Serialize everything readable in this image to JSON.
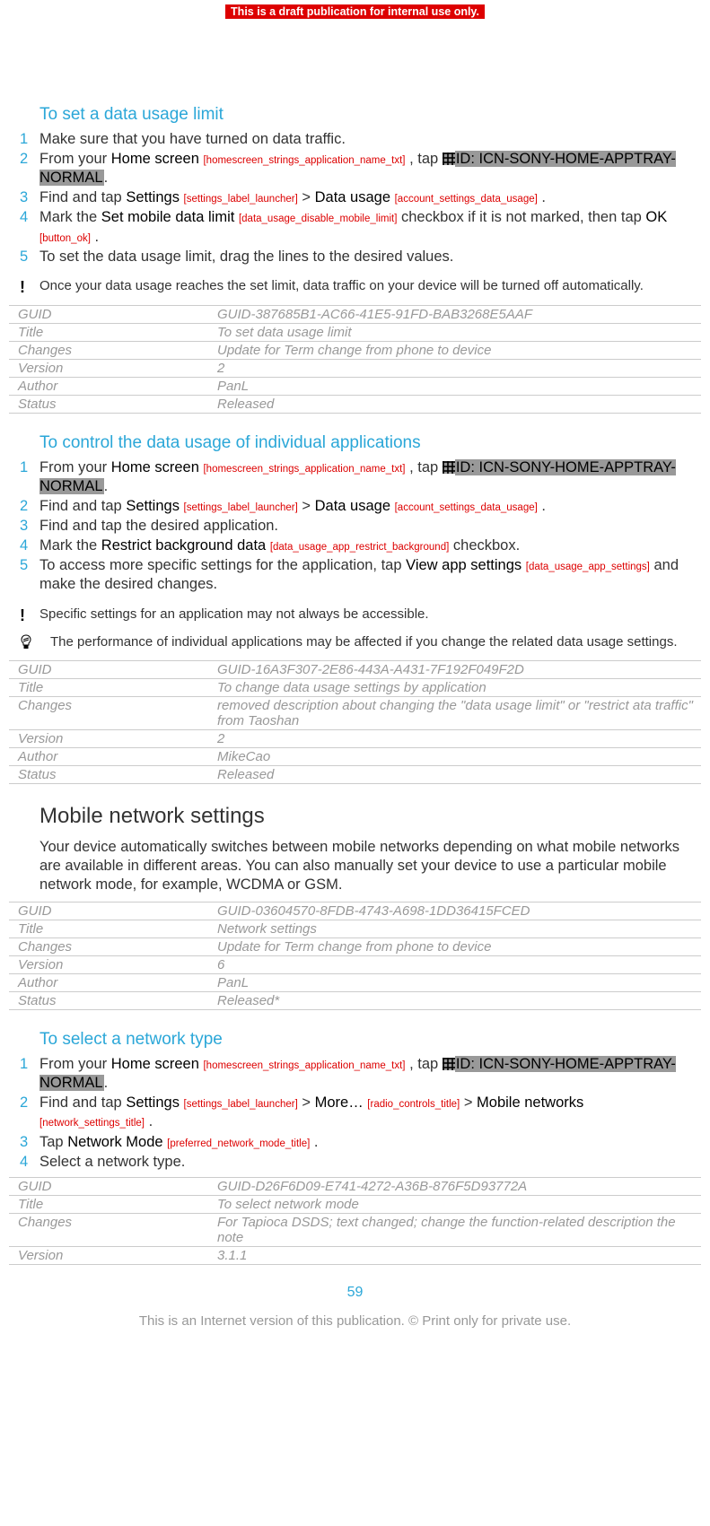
{
  "banner": "This is a draft publication for internal use only.",
  "sec1": {
    "title": "To set a data usage limit",
    "steps": [
      {
        "n": "1",
        "parts": [
          "Make sure that you have turned on data traffic."
        ]
      },
      {
        "n": "2",
        "parts": [
          "From your ",
          "Home screen",
          " [homescreen_strings_application_name_txt] ",
          ", tap ",
          "ID: ICN-SONY-HOME-APPTRAY-NORMAL",
          "."
        ]
      },
      {
        "n": "3",
        "parts": [
          "Find and tap ",
          "Settings",
          " [settings_label_launcher] ",
          " > ",
          "Data usage",
          " [account_settings_data_usage] ",
          "."
        ]
      },
      {
        "n": "4",
        "parts": [
          "Mark the ",
          "Set mobile data limit",
          " [data_usage_disable_mobile_limit] ",
          " checkbox if it is not marked, then tap ",
          "OK",
          " [button_ok] ",
          "."
        ]
      },
      {
        "n": "5",
        "parts": [
          "To set the data usage limit, drag the lines to the desired values."
        ]
      }
    ],
    "note": "Once your data usage reaches the set limit, data traffic on your device will be turned off automatically.",
    "meta": [
      [
        "GUID",
        "GUID-387685B1-AC66-41E5-91FD-BAB3268E5AAF"
      ],
      [
        "Title",
        "To set data usage limit"
      ],
      [
        "Changes",
        "Update for Term change from phone to device"
      ],
      [
        "Version",
        "2"
      ],
      [
        "Author",
        "PanL"
      ],
      [
        "Status",
        "Released"
      ]
    ]
  },
  "sec2": {
    "title": "To control the data usage of individual applications",
    "steps": [
      {
        "n": "1",
        "parts": [
          "From your ",
          "Home screen",
          " [homescreen_strings_application_name_txt] ",
          ", tap ",
          "ID: ICN-SONY-HOME-APPTRAY-NORMAL",
          "."
        ]
      },
      {
        "n": "2",
        "parts": [
          "Find and tap ",
          "Settings",
          " [settings_label_launcher] ",
          " > ",
          "Data usage",
          " [account_settings_data_usage] ",
          "."
        ]
      },
      {
        "n": "3",
        "parts": [
          "Find and tap the desired application."
        ]
      },
      {
        "n": "4",
        "parts": [
          "Mark the ",
          "Restrict background data",
          " [data_usage_app_restrict_background] ",
          " checkbox."
        ]
      },
      {
        "n": "5",
        "parts": [
          "To access more specific settings for the application, tap ",
          "View app settings",
          " [data_usage_app_settings] ",
          " and make the desired changes."
        ]
      }
    ],
    "note": "Specific settings for an application may not always be accessible.",
    "tip": "The performance of individual applications may be affected if you change the related data usage settings.",
    "meta": [
      [
        "GUID",
        "GUID-16A3F307-2E86-443A-A431-7F192F049F2D"
      ],
      [
        "Title",
        "To change data usage settings by application"
      ],
      [
        "Changes",
        "removed description about changing the \"data usage limit\" or \"restrict ata traffic\" from Taoshan"
      ],
      [
        "Version",
        "2"
      ],
      [
        "Author",
        "MikeCao"
      ],
      [
        "Status",
        "Released"
      ]
    ]
  },
  "sec3": {
    "heading": "Mobile network settings",
    "para": "Your device automatically switches between mobile networks depending on what mobile networks are available in different areas. You can also manually set your device to use a particular mobile network mode, for example, WCDMA or GSM.",
    "meta": [
      [
        "GUID",
        "GUID-03604570-8FDB-4743-A698-1DD36415FCED"
      ],
      [
        "Title",
        "Network settings"
      ],
      [
        "Changes",
        "Update for Term change from phone to device"
      ],
      [
        "Version",
        "6"
      ],
      [
        "Author",
        "PanL"
      ],
      [
        "Status",
        "Released*"
      ]
    ]
  },
  "sec4": {
    "title": "To select a network type",
    "steps": [
      {
        "n": "1",
        "parts": [
          "From your ",
          "Home screen",
          " [homescreen_strings_application_name_txt] ",
          ", tap ",
          "ID: ICN-SONY-HOME-APPTRAY-NORMAL",
          "."
        ]
      },
      {
        "n": "2",
        "parts": [
          "Find and tap ",
          "Settings",
          " [settings_label_launcher] ",
          " > ",
          "More…",
          " [radio_controls_title] ",
          " > ",
          "Mobile networks",
          " [network_settings_title] ",
          "."
        ]
      },
      {
        "n": "3",
        "parts": [
          "Tap ",
          "Network Mode",
          " [preferred_network_mode_title] ",
          "."
        ]
      },
      {
        "n": "4",
        "parts": [
          "Select a network type."
        ]
      }
    ],
    "meta": [
      [
        "GUID",
        "GUID-D26F6D09-E741-4272-A36B-876F5D93772A"
      ],
      [
        "Title",
        "To select network mode"
      ],
      [
        "Changes",
        "For Tapioca DSDS; text changed; change the function-related description the note"
      ],
      [
        "Version",
        "3.1.1"
      ]
    ]
  },
  "pageNum": "59",
  "footer": "This is an Internet version of this publication. © Print only for private use."
}
